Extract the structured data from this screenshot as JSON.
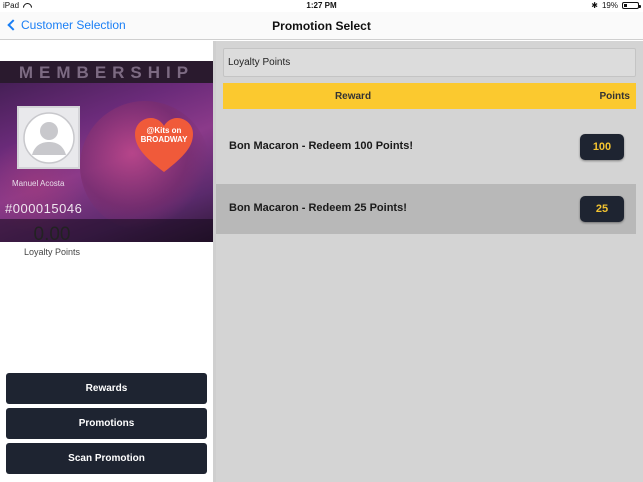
{
  "statusbar": {
    "device": "iPad",
    "time": "1:27 PM",
    "battery_text": "19%",
    "battery_level": 0.19
  },
  "navbar": {
    "back_label": "Customer Selection",
    "title": "Promotion Select"
  },
  "member_card": {
    "title": "MEMBERSHIP",
    "member_name": "Manuel Acosta",
    "member_number": "#000015046",
    "logo_text": "@Kits on BROADWAY"
  },
  "loyalty": {
    "value": "0.00",
    "label": "Loyalty Points"
  },
  "left_buttons": [
    {
      "label": "Rewards"
    },
    {
      "label": "Promotions"
    },
    {
      "label": "Scan Promotion"
    }
  ],
  "right": {
    "section_title": "Loyalty Points",
    "columns": {
      "reward": "Reward",
      "points": "Points"
    },
    "rows": [
      {
        "reward": "Bon Macaron - Redeem 100 Points!",
        "points": "100",
        "selected": false
      },
      {
        "reward": "Bon Macaron - Redeem 25 Points!",
        "points": "25",
        "selected": true
      }
    ]
  },
  "colors": {
    "accent_yellow": "#fbc92f",
    "button_dark": "#1e2431",
    "link_blue": "#1a7ff5"
  }
}
